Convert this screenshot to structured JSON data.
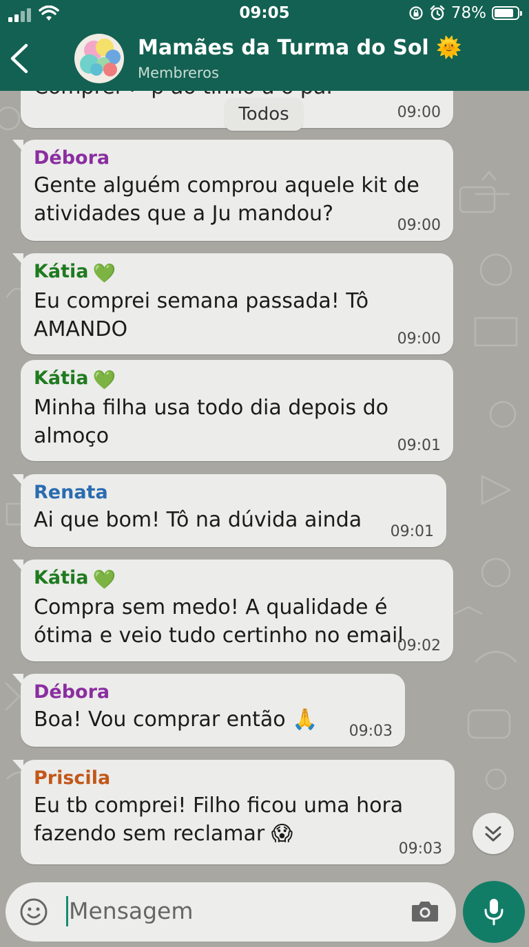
{
  "status_bar": {
    "time": "09:05",
    "battery": "78%",
    "battery_level": 0.78
  },
  "header": {
    "title": "Mamães da Turma do Sol",
    "title_emoji": "🌞",
    "subtitle": "Membreros"
  },
  "filter_chip": "Todos",
  "messages": [
    {
      "sender": "",
      "text": "Comprei ✓ p ao tinho a o pa.",
      "time": "09:00",
      "sender_color": "#000000"
    },
    {
      "sender": "Débora",
      "text": "Gente alguém comprou aquele kit de atividades que a Ju mandou?",
      "time": "09:00",
      "sender_color": "#8a2ea0"
    },
    {
      "sender": "Kátia",
      "text": "Eu comprei semana passada! Tô AMANDO",
      "time": "09:00",
      "sender_color": "#1f7a1f",
      "heart": "💚"
    },
    {
      "sender": "Kátia",
      "text": "Minha filha usa todo dia depois do almoço",
      "time": "09:01",
      "sender_color": "#1f7a1f",
      "heart": "💚"
    },
    {
      "sender": "Renata",
      "text": "Ai que bom! Tô na dúvida ainda",
      "time": "09:01",
      "sender_color": "#2b6cb0"
    },
    {
      "sender": "Kátia",
      "text": "Compra sem medo! A qualidade é ótima e veio tudo certinho no email",
      "time": "09:02",
      "sender_color": "#1f7a1f",
      "heart": "💚"
    },
    {
      "sender": "Débora",
      "text": "Boa! Vou comprar então 🙏",
      "time": "09:03",
      "sender_color": "#8a2ea0"
    },
    {
      "sender": "Priscila",
      "text": "Eu tb comprei! Filho ficou uma hora fazendo sem reclamar 😱",
      "time": "09:03",
      "sender_color": "#c2571a"
    }
  ],
  "input": {
    "placeholder": "Mensagem"
  },
  "icons": [
    "back-arrow-icon",
    "group-avatar-icon",
    "emoji-icon",
    "camera-icon",
    "mic-icon",
    "chevron-down-icon",
    "signal-icon",
    "wifi-icon",
    "battery-icon",
    "alarm-icon",
    "lock-rotation-icon"
  ]
}
